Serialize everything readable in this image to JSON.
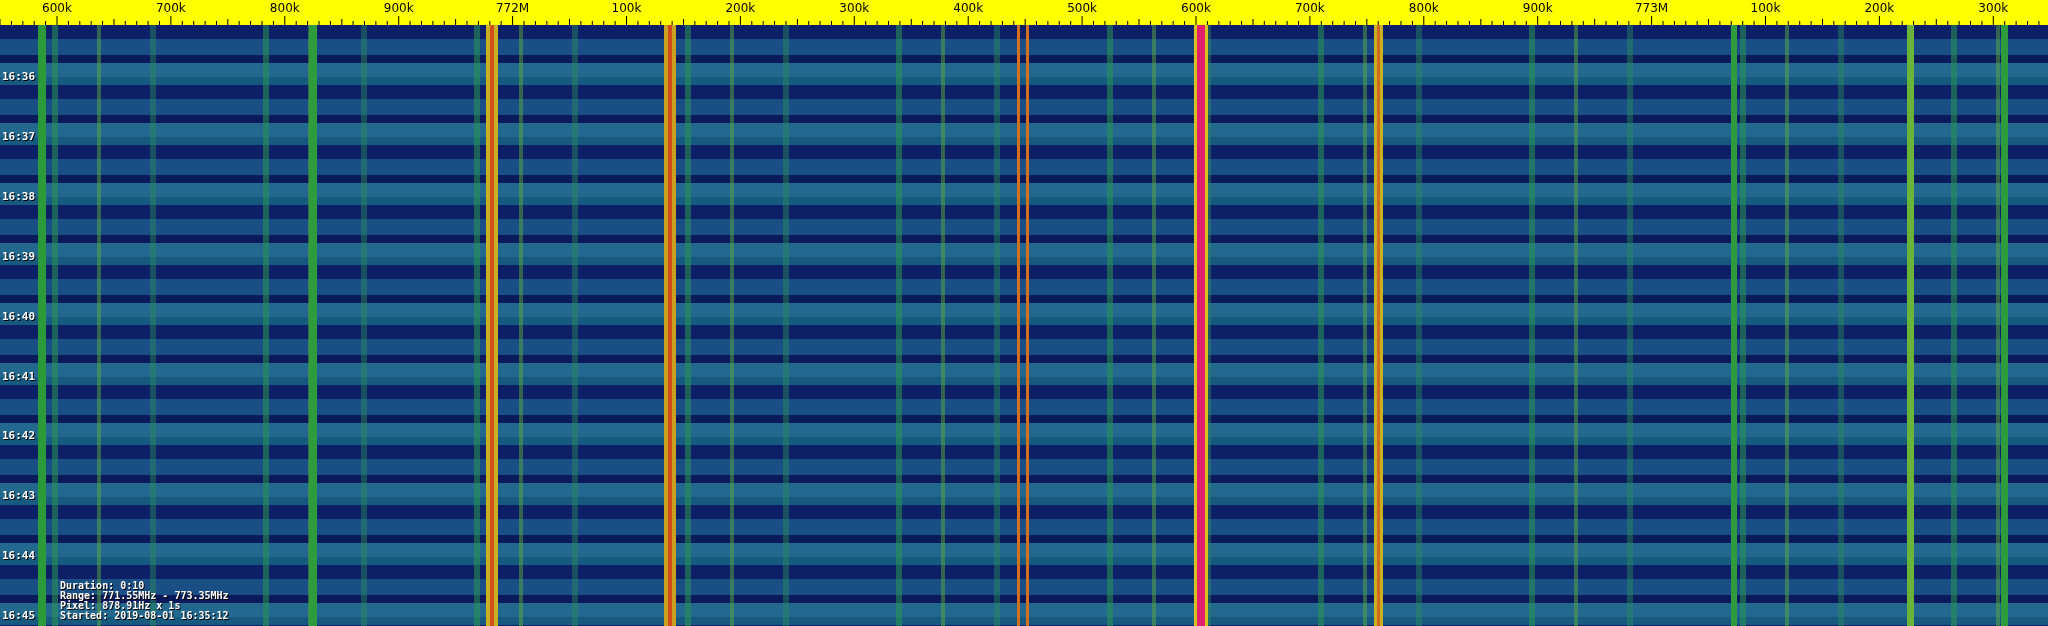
{
  "frequency_axis": {
    "labels": [
      "600k",
      "700k",
      "800k",
      "900k",
      "772M",
      "100k",
      "200k",
      "300k",
      "400k",
      "500k",
      "600k",
      "700k",
      "800k",
      "900k",
      "773M",
      "100k",
      "200k",
      "300k"
    ]
  },
  "time_axis": {
    "labels": [
      "16:36",
      "16:37",
      "16:38",
      "16:39",
      "16:40",
      "16:41",
      "16:42",
      "16:43",
      "16:44",
      "16:45"
    ]
  },
  "info": {
    "lines": [
      "Duration: 0:10",
      "Range: 771.55MHz - 773.35MHz",
      "Pixel: 878.91Hz x 1s",
      "Started: 2019-08-01 16:35:12"
    ]
  }
}
